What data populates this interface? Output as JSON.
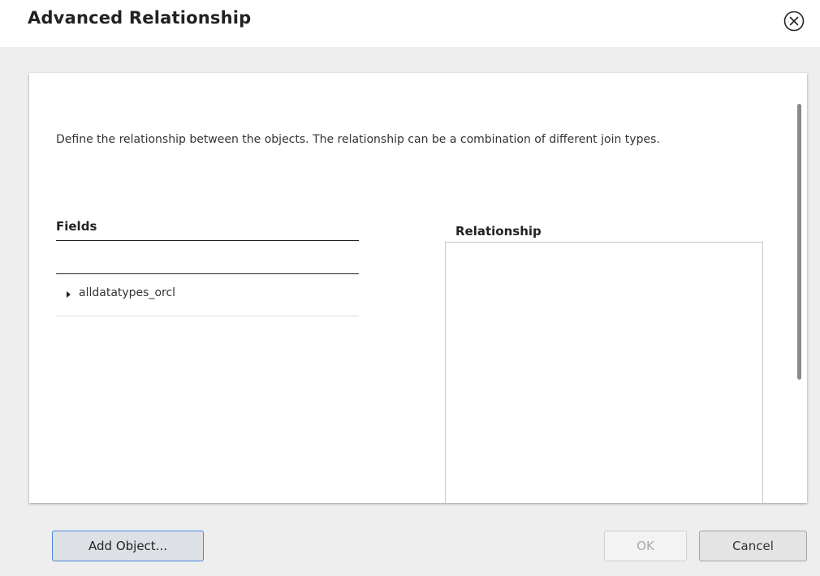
{
  "dialog": {
    "title": "Advanced Relationship",
    "close_icon": "close-circle-icon"
  },
  "content": {
    "description": "Define the relationship between the objects. The relationship can be a combination of different join types.",
    "fields": {
      "header": "Fields",
      "tree_items": [
        {
          "label": "alldatatypes_orcl",
          "expanded": false,
          "icon": "caret-right-icon"
        }
      ]
    },
    "relationship": {
      "header": "Relationship"
    }
  },
  "footer": {
    "add_object_label": "Add Object...",
    "ok_label": "OK",
    "ok_disabled": true,
    "cancel_label": "Cancel"
  },
  "colors": {
    "body_background": "#eeeeee",
    "focus_border": "#4a88d8",
    "disabled_text": "#a8a8a8"
  }
}
